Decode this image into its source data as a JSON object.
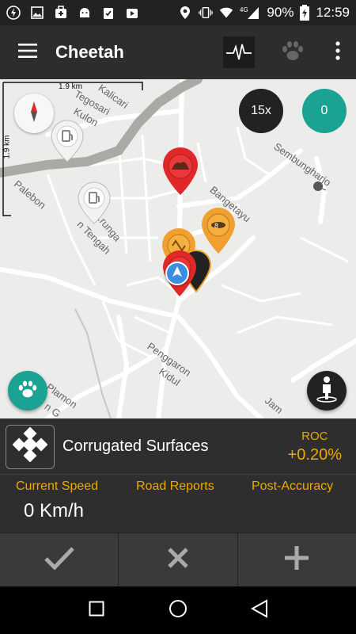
{
  "status": {
    "network": "4G",
    "battery": "90%",
    "time": "12:59"
  },
  "appbar": {
    "title": "Cheetah"
  },
  "map": {
    "zoom": "15x",
    "count": "0",
    "scale_top": "1.9 km",
    "scale_side": "1.9 km",
    "labels": [
      "Kalicari",
      "Tegosari",
      "Kulon",
      "Palebon",
      "Sembungharjo",
      "Bangetayu",
      "...runga",
      "n Tengah",
      "Penggaron",
      "Kidul",
      "Plamon",
      "n G",
      "Jam"
    ],
    "marker_numbers": {
      "orange_pin": "8"
    }
  },
  "panel": {
    "surface_name": "Corrugated Surfaces",
    "roc_label": "ROC",
    "roc_value": "+0.20%",
    "stat_labels": [
      "Current Speed",
      "Road Reports",
      "Post-Accuracy"
    ],
    "speed_value": "0 Km/h"
  },
  "colors": {
    "accent": "#f0a800",
    "teal": "#1aa292",
    "pin_red": "#e02828",
    "pin_orange": "#f0a030"
  },
  "icons": {
    "menu": "hamburger-icon",
    "pulse": "pulse-icon",
    "paw": "paw-icon",
    "more": "more-vert-icon",
    "check": "check-icon",
    "close": "close-icon",
    "add": "add-icon"
  }
}
